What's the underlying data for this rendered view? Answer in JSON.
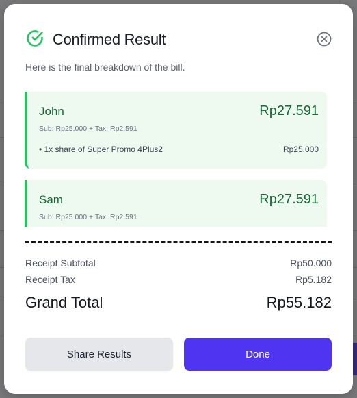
{
  "modal": {
    "title": "Confirmed Result",
    "subtitle": "Here is the final breakdown of the bill.",
    "accent_color": "#22c55e",
    "primary_color": "#4f35f2"
  },
  "people": [
    {
      "name": "John",
      "total": "Rp27.591",
      "breakdown": "Sub: Rp25.000 + Tax: Rp2.591",
      "items": [
        {
          "label": "• 1x share of Super Promo 4Plus2",
          "amount": "Rp25.000"
        }
      ]
    },
    {
      "name": "Sam",
      "total": "Rp27.591",
      "breakdown": "Sub: Rp25.000 + Tax: Rp2.591"
    }
  ],
  "summary": {
    "subtotal_label": "Receipt Subtotal",
    "subtotal_value": "Rp50.000",
    "tax_label": "Receipt Tax",
    "tax_value": "Rp5.182",
    "grand_label": "Grand Total",
    "grand_value": "Rp55.182"
  },
  "buttons": {
    "share": "Share Results",
    "done": "Done"
  },
  "icons": {
    "header": "check-circle-icon",
    "close": "close-circle-icon"
  }
}
